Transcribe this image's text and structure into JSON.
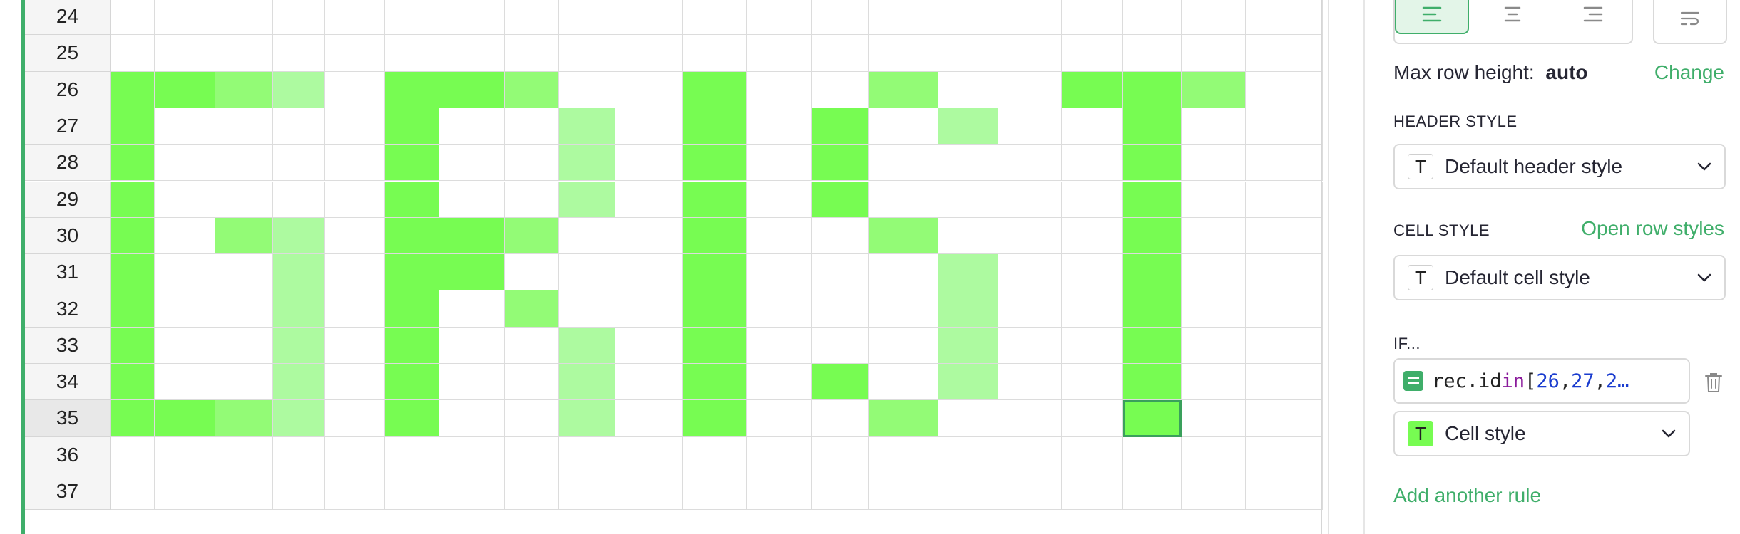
{
  "grid": {
    "rows": [
      {
        "label": "24",
        "fills": [
          0,
          0,
          0,
          0,
          0,
          0,
          0,
          0,
          0,
          0,
          0,
          0,
          0,
          0,
          0,
          0,
          0,
          0,
          0,
          0
        ]
      },
      {
        "label": "25",
        "fills": [
          0,
          0,
          0,
          0,
          0,
          0,
          0,
          0,
          0,
          0,
          0,
          0,
          0,
          0,
          0,
          0,
          0,
          0,
          0,
          0
        ]
      },
      {
        "label": "26",
        "fills": [
          1,
          1,
          2,
          3,
          0,
          1,
          1,
          2,
          0,
          0,
          1,
          0,
          0,
          2,
          0,
          0,
          1,
          1,
          2,
          0
        ]
      },
      {
        "label": "27",
        "fills": [
          1,
          0,
          0,
          0,
          0,
          1,
          0,
          0,
          3,
          0,
          1,
          0,
          1,
          0,
          3,
          0,
          0,
          1,
          0,
          0
        ]
      },
      {
        "label": "28",
        "fills": [
          1,
          0,
          0,
          0,
          0,
          1,
          0,
          0,
          3,
          0,
          1,
          0,
          1,
          0,
          0,
          0,
          0,
          1,
          0,
          0
        ]
      },
      {
        "label": "29",
        "fills": [
          1,
          0,
          0,
          0,
          0,
          1,
          0,
          0,
          3,
          0,
          1,
          0,
          1,
          0,
          0,
          0,
          0,
          1,
          0,
          0
        ]
      },
      {
        "label": "30",
        "fills": [
          1,
          0,
          2,
          3,
          0,
          1,
          1,
          2,
          0,
          0,
          1,
          0,
          0,
          2,
          0,
          0,
          0,
          1,
          0,
          0
        ]
      },
      {
        "label": "31",
        "fills": [
          1,
          0,
          0,
          3,
          0,
          1,
          1,
          0,
          0,
          0,
          1,
          0,
          0,
          0,
          3,
          0,
          0,
          1,
          0,
          0
        ]
      },
      {
        "label": "32",
        "fills": [
          1,
          0,
          0,
          3,
          0,
          1,
          0,
          2,
          0,
          0,
          1,
          0,
          0,
          0,
          3,
          0,
          0,
          1,
          0,
          0
        ]
      },
      {
        "label": "33",
        "fills": [
          1,
          0,
          0,
          3,
          0,
          1,
          0,
          0,
          3,
          0,
          1,
          0,
          0,
          0,
          3,
          0,
          0,
          1,
          0,
          0
        ]
      },
      {
        "label": "34",
        "fills": [
          1,
          0,
          0,
          3,
          0,
          1,
          0,
          0,
          3,
          0,
          1,
          0,
          1,
          0,
          3,
          0,
          0,
          1,
          0,
          0
        ]
      },
      {
        "label": "35",
        "fills": [
          1,
          1,
          2,
          3,
          0,
          1,
          0,
          0,
          3,
          0,
          1,
          0,
          0,
          2,
          0,
          0,
          0,
          1,
          0,
          0
        ]
      },
      {
        "label": "36",
        "fills": [
          0,
          0,
          0,
          0,
          0,
          0,
          0,
          0,
          0,
          0,
          0,
          0,
          0,
          0,
          0,
          0,
          0,
          0,
          0,
          0
        ]
      },
      {
        "label": "37",
        "fills": [
          0,
          0,
          0,
          0,
          0,
          0,
          0,
          0,
          0,
          0,
          0,
          0,
          0,
          0,
          0,
          0,
          0,
          0,
          0,
          0
        ]
      }
    ],
    "active_row": "35",
    "selected_cell": {
      "row": "35",
      "col_index": 17
    },
    "colors": {
      "fill_1": "#77fc52",
      "fill_2": "#93fb76",
      "fill_3": "#adfaa0",
      "accent": "#3fae6a"
    }
  },
  "panel": {
    "alignment": {
      "options": [
        "align-left-icon",
        "align-center-icon",
        "align-right-icon"
      ],
      "active": "align-left-icon",
      "wrap_icon": "wrap-text-icon"
    },
    "max_row_height_label": "Max row height:",
    "max_row_height_value": "auto",
    "change_link": "Change",
    "header_style_section": "HEADER STYLE",
    "header_style_value": "Default header style",
    "header_style_badge": "T",
    "cell_style_section": "CELL STYLE",
    "open_row_styles_link": "Open row styles",
    "cell_style_value": "Default cell style",
    "cell_style_badge": "T",
    "if_section": "IF...",
    "rule": {
      "formula_parts": {
        "p1": "rec.id ",
        "kw": "in",
        "p2": " [",
        "n1": "26",
        "sep1": ", ",
        "n2": "27",
        "sep2": ", ",
        "n3": "2…"
      },
      "style_value": "Cell style",
      "style_badge": "T"
    },
    "add_rule_link": "Add another rule"
  }
}
